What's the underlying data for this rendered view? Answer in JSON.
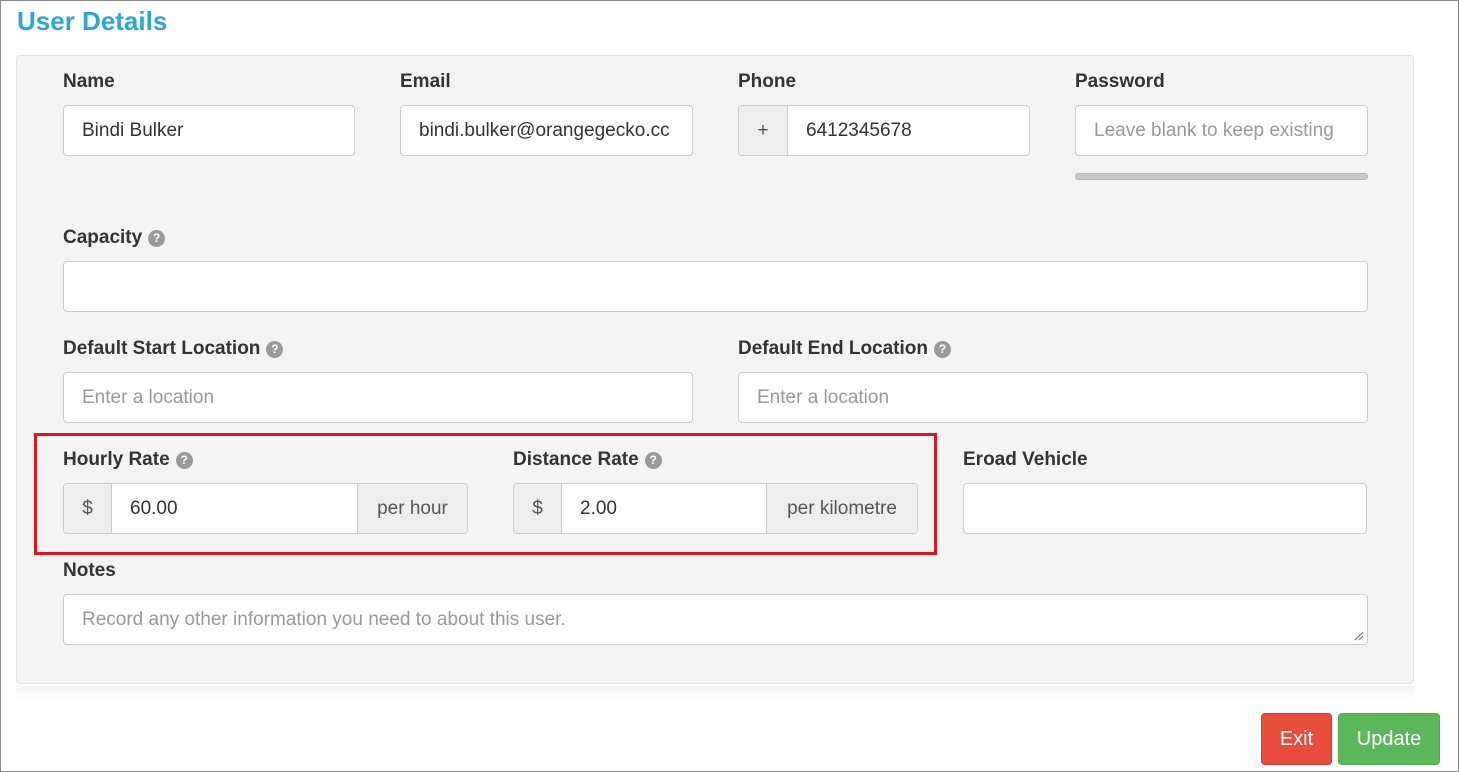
{
  "page": {
    "title": "User Details"
  },
  "fields": {
    "name": {
      "label": "Name",
      "value": "Bindi Bulker"
    },
    "email": {
      "label": "Email",
      "value": "bindi.bulker@orangegecko.cc"
    },
    "phone": {
      "label": "Phone",
      "prefix": "+",
      "value": "6412345678"
    },
    "password": {
      "label": "Password",
      "placeholder": "Leave blank to keep existing"
    },
    "capacity": {
      "label": "Capacity",
      "value": ""
    },
    "start_location": {
      "label": "Default Start Location",
      "placeholder": "Enter a location"
    },
    "end_location": {
      "label": "Default End Location",
      "placeholder": "Enter a location"
    },
    "hourly_rate": {
      "label": "Hourly Rate",
      "prefix": "$",
      "value": "60.00",
      "suffix": "per hour"
    },
    "distance_rate": {
      "label": "Distance Rate",
      "prefix": "$",
      "value": "2.00",
      "suffix": "per kilometre"
    },
    "eroad_vehicle": {
      "label": "Eroad Vehicle",
      "value": ""
    },
    "notes": {
      "label": "Notes",
      "placeholder": "Record any other information you need to about this user."
    }
  },
  "help_glyph": "?",
  "buttons": {
    "exit": "Exit",
    "update": "Update"
  },
  "colors": {
    "title": "#2fa4dc",
    "highlight": "#e0151f",
    "exit": "#e74c3c",
    "update": "#5cb85c"
  },
  "icons": {
    "help": "question-circle-icon",
    "resize": "textarea-resize-icon"
  }
}
